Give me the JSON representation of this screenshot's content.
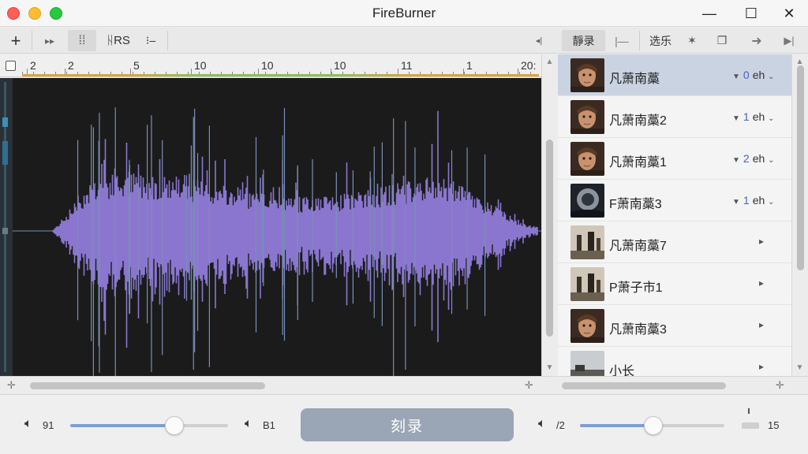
{
  "window": {
    "title": "FireBurner",
    "minimize_glyph": "—",
    "maximize_glyph": "☐",
    "close_glyph": "✕"
  },
  "toolbar_left": {
    "add_glyph": "+",
    "forward_glyph": "▸▸",
    "split_glyph": "⁞⁞",
    "text_label": "ᚺRS",
    "list_glyph": "⁝–",
    "edge_label": "◂|"
  },
  "toolbar_right": {
    "tab1_label": "靜录",
    "tab2_glyph": "|—",
    "tab3_label": "选乐",
    "sparkle_glyph": "✶",
    "copy_glyph": "❐",
    "arrow_glyph": "➜",
    "play_glyph": "▶|"
  },
  "ruler": {
    "labels": [
      "2",
      "2",
      "5",
      "10",
      "10",
      "10",
      "11",
      "1",
      "20:"
    ]
  },
  "waveform": {
    "color": "#8b76cf",
    "background": "#1b1b1b",
    "spike_color": "#7a8fb6"
  },
  "tracks": [
    {
      "name": "凡萧南藁",
      "count": "0",
      "unit": "eh",
      "has_count": true,
      "selected": true,
      "thumb": "portrait"
    },
    {
      "name": "凡萧南藁2",
      "count": "1",
      "unit": "eh",
      "has_count": true,
      "selected": false,
      "thumb": "portrait"
    },
    {
      "name": "凡萧南藁1",
      "count": "2",
      "unit": "eh",
      "has_count": true,
      "selected": false,
      "thumb": "portrait"
    },
    {
      "name": "F萧南藁3",
      "count": "1",
      "unit": "eh",
      "has_count": true,
      "selected": false,
      "thumb": "storm"
    },
    {
      "name": "凡萧南藁7",
      "count": "",
      "unit": "",
      "has_count": false,
      "selected": false,
      "thumb": "ruins"
    },
    {
      "name": "P萧子市1",
      "count": "",
      "unit": "",
      "has_count": false,
      "selected": false,
      "thumb": "ruins"
    },
    {
      "name": "凡萧南藁3",
      "count": "",
      "unit": "",
      "has_count": false,
      "selected": false,
      "thumb": "portrait"
    },
    {
      "name": "小长",
      "count": "",
      "unit": "",
      "has_count": false,
      "selected": false,
      "thumb": "landscape"
    }
  ],
  "bottom": {
    "left_volume_label": "91",
    "mid_volume_label": "B1",
    "burn_label": "刻录",
    "right_volume_label": "/2",
    "end_label": "15",
    "left_slider_fraction": 0.66,
    "right_slider_fraction": 0.51
  },
  "icons": {
    "speaker": "speaker-icon",
    "move": "move-icon",
    "scroll_up": "chevron-up-icon",
    "scroll_down": "chevron-down-icon"
  }
}
